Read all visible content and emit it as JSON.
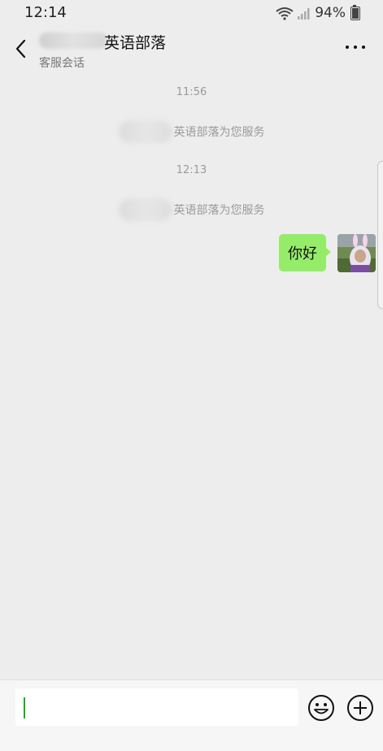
{
  "status_bar": {
    "time": "12:14",
    "battery_percent": "94%",
    "battery_level": 0.94
  },
  "header": {
    "title": "英语部落",
    "subtitle": "客服会话",
    "back_icon": "chevron-left-icon",
    "more_icon": "more-icon"
  },
  "messages": [
    {
      "type": "timestamp",
      "text": "11:56"
    },
    {
      "type": "system",
      "text": "英语部落为您服务"
    },
    {
      "type": "timestamp",
      "text": "12:13"
    },
    {
      "type": "system",
      "text": "英语部落为您服务"
    },
    {
      "type": "outgoing",
      "text": "你好"
    }
  ],
  "input_bar": {
    "value": "",
    "emoji_icon": "emoji-icon",
    "plus_icon": "plus-icon"
  },
  "colors": {
    "bubble": "#95ec69",
    "background": "#ededed",
    "caret": "#1aad19"
  }
}
